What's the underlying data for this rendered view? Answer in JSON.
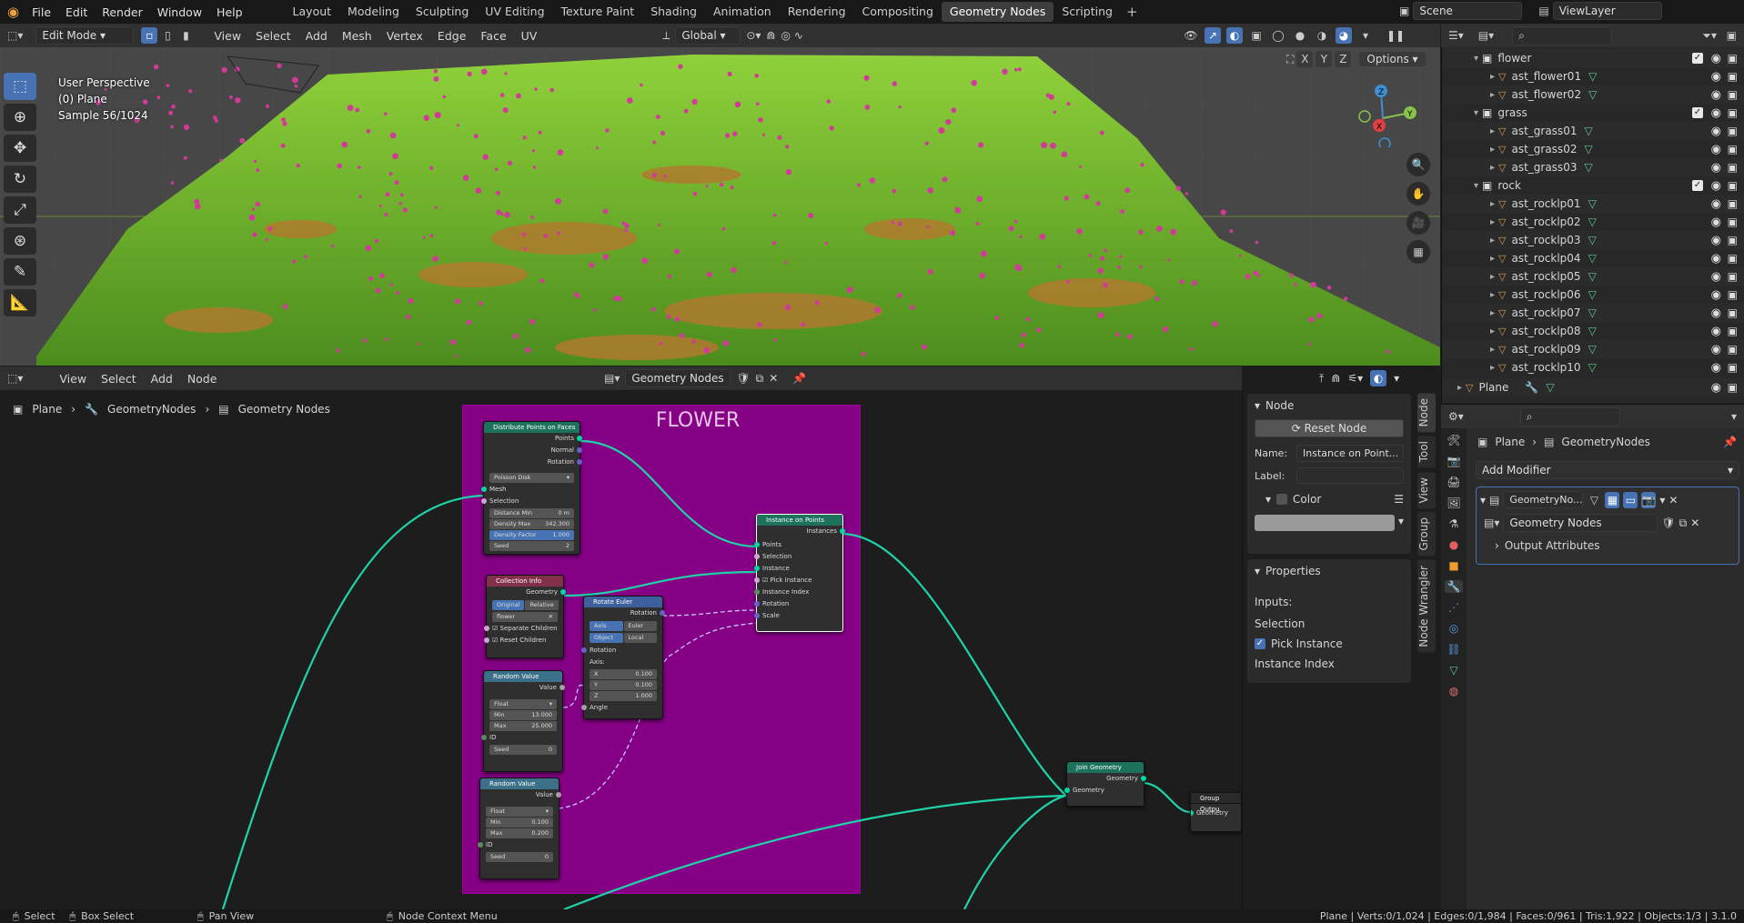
{
  "menu": [
    "File",
    "Edit",
    "Render",
    "Window",
    "Help"
  ],
  "workspaces": [
    "Layout",
    "Modeling",
    "Sculpting",
    "UV Editing",
    "Texture Paint",
    "Shading",
    "Animation",
    "Rendering",
    "Compositing",
    "Geometry Nodes",
    "Scripting"
  ],
  "active_workspace": "Geometry Nodes",
  "scene_name": "Scene",
  "view_layer": "ViewLayer",
  "viewport": {
    "mode": "Edit Mode",
    "menus": [
      "View",
      "Select",
      "Add",
      "Mesh",
      "Vertex",
      "Edge",
      "Face",
      "UV"
    ],
    "transform_orientation": "Global",
    "options_label": "Options",
    "axis_labels": [
      "X",
      "Y",
      "Z"
    ],
    "info_lines": [
      "User Perspective",
      "(0) Plane",
      "Sample 56/1024"
    ]
  },
  "outliner": {
    "rows": [
      {
        "label": "flower",
        "type": "collection",
        "level": 0
      },
      {
        "label": "ast_flower01",
        "type": "object",
        "level": 1
      },
      {
        "label": "ast_flower02",
        "type": "object",
        "level": 1
      },
      {
        "label": "grass",
        "type": "collection",
        "level": 0
      },
      {
        "label": "ast_grass01",
        "type": "object",
        "level": 1
      },
      {
        "label": "ast_grass02",
        "type": "object",
        "level": 1
      },
      {
        "label": "ast_grass03",
        "type": "object",
        "level": 1
      },
      {
        "label": "rock",
        "type": "collection",
        "level": 0
      },
      {
        "label": "ast_rocklp01",
        "type": "object",
        "level": 1
      },
      {
        "label": "ast_rocklp02",
        "type": "object",
        "level": 1
      },
      {
        "label": "ast_rocklp03",
        "type": "object",
        "level": 1
      },
      {
        "label": "ast_rocklp04",
        "type": "object",
        "level": 1
      },
      {
        "label": "ast_rocklp05",
        "type": "object",
        "level": 1
      },
      {
        "label": "ast_rocklp06",
        "type": "object",
        "level": 1
      },
      {
        "label": "ast_rocklp07",
        "type": "object",
        "level": 1
      },
      {
        "label": "ast_rocklp08",
        "type": "object",
        "level": 1
      },
      {
        "label": "ast_rocklp09",
        "type": "object",
        "level": 1
      },
      {
        "label": "ast_rocklp10",
        "type": "object",
        "level": 1
      }
    ],
    "plane_row": "Plane"
  },
  "properties": {
    "breadcrumb_object": "Plane",
    "breadcrumb_modifier": "GeometryNodes",
    "add_modifier": "Add Modifier",
    "modifier_name": "GeometryNo...",
    "node_group": "Geometry Nodes",
    "output_attributes": "Output Attributes"
  },
  "node_editor": {
    "menus": [
      "View",
      "Select",
      "Add",
      "Node"
    ],
    "node_tree": "Geometry Nodes",
    "breadcrumb": [
      "Plane",
      "GeometryNodes",
      "Geometry Nodes"
    ],
    "frame_label": "FLOWER"
  },
  "nodes": {
    "distribute": {
      "title": "Distribute Points on Faces",
      "out": [
        "Points",
        "Normal",
        "Rotation"
      ],
      "method": "Poisson Disk",
      "in": [
        "Mesh",
        "Selection"
      ],
      "distance_min_label": "Distance Min",
      "distance_min": "0 m",
      "density_max_label": "Density Max",
      "density_max": "342.300",
      "density_factor_label": "Density Factor",
      "density_factor": "1.000",
      "seed_label": "Seed",
      "seed": "2"
    },
    "collection_info": {
      "title": "Collection Info",
      "out": "Geometry",
      "tabs": [
        "Original",
        "Relative"
      ],
      "collection": "flower",
      "sep": "Separate Children",
      "reset": "Reset Children"
    },
    "rotate_euler": {
      "title": "Rotate Euler",
      "out": "Rotation",
      "tabs1": [
        "Axis Angle",
        "Euler"
      ],
      "tabs2": [
        "Object",
        "Local"
      ],
      "rotation": "Rotation",
      "axis": "Axis:",
      "x_label": "X",
      "x": "0.100",
      "y_label": "Y",
      "y": "0.100",
      "z_label": "Z",
      "z": "1.000",
      "angle": "Angle"
    },
    "random1": {
      "title": "Random Value",
      "out": "Value",
      "type": "Float",
      "min_label": "Min",
      "min": "13.000",
      "max_label": "Max",
      "max": "25.000",
      "id": "ID",
      "seed_label": "Seed",
      "seed": "0"
    },
    "random2": {
      "title": "Random Value",
      "out": "Value",
      "type": "Float",
      "min_label": "Min",
      "min": "0.100",
      "max_label": "Max",
      "max": "0.200",
      "id": "ID",
      "seed_label": "Seed",
      "seed": "0"
    },
    "instance": {
      "title": "Instance on Points",
      "out": "Instances",
      "in": [
        "Points",
        "Selection",
        "Instance",
        "Pick Instance",
        "Instance Index",
        "Rotation",
        "Scale"
      ]
    },
    "join": {
      "title": "Join Geometry",
      "out": "Geometry",
      "in": "Geometry"
    },
    "group_output": {
      "title": "Group Outpu",
      "in": "Geometry"
    }
  },
  "npanel": {
    "section_node": "Node",
    "reset_node": "Reset Node",
    "name_label": "Name:",
    "name_value": "Instance on Point...",
    "label_label": "Label:",
    "color_label": "Color",
    "section_properties": "Properties",
    "inputs_label": "Inputs:",
    "selection": "Selection",
    "pick_instance": "Pick Instance",
    "instance_index": "Instance Index",
    "tabs": [
      "Node",
      "Tool",
      "View",
      "Group",
      "Node Wrangler"
    ]
  },
  "statusbar": {
    "select": "Select",
    "box_select": "Box Select",
    "pan_view": "Pan View",
    "context_menu": "Node Context Menu",
    "stats": "Plane | Verts:0/1,024 | Edges:0/1,984 | Faces:0/961 | Tris:1,922 | Objects:1/3 | 3.1.0"
  },
  "colors": {
    "accent": "#4772b3",
    "frame": "#860086",
    "geometry_socket": "#00d6a3",
    "grass": "#6fae2a",
    "flower": "#d23a9a"
  }
}
